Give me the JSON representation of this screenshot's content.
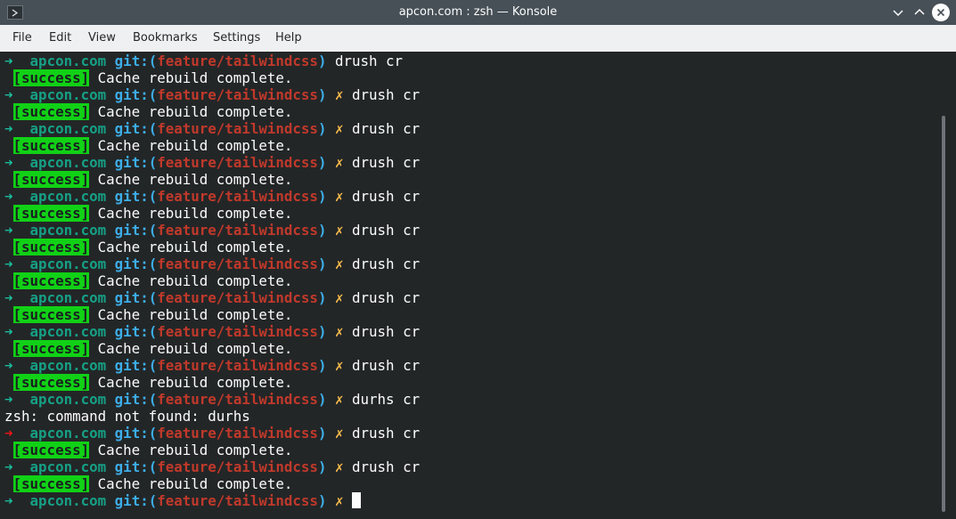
{
  "window": {
    "title": "apcon.com : zsh — Konsole",
    "icons": {
      "app": "terminal-icon",
      "minimize": "chevron-down-icon",
      "maximize": "chevron-up-icon",
      "close": "close-icon"
    }
  },
  "menu": [
    "File",
    "Edit",
    "View",
    "Bookmarks",
    "Settings",
    "Help"
  ],
  "prompt": {
    "arrow": "➜",
    "host": "apcon.com",
    "git_open": "git:(",
    "branch": "feature/tailwindcss",
    "git_close": ")",
    "dirty": "✗"
  },
  "terminal_lines": [
    {
      "kind": "prompt",
      "status": "ok",
      "dirty": false,
      "cmd": "drush cr"
    },
    {
      "kind": "success",
      "badge": "[success]",
      "text": "Cache rebuild complete."
    },
    {
      "kind": "prompt",
      "status": "ok",
      "dirty": true,
      "cmd": "drush cr"
    },
    {
      "kind": "success",
      "badge": "[success]",
      "text": "Cache rebuild complete."
    },
    {
      "kind": "prompt",
      "status": "ok",
      "dirty": true,
      "cmd": "drush cr"
    },
    {
      "kind": "success",
      "badge": "[success]",
      "text": "Cache rebuild complete."
    },
    {
      "kind": "prompt",
      "status": "ok",
      "dirty": true,
      "cmd": "drush cr"
    },
    {
      "kind": "success",
      "badge": "[success]",
      "text": "Cache rebuild complete."
    },
    {
      "kind": "prompt",
      "status": "ok",
      "dirty": true,
      "cmd": "drush cr"
    },
    {
      "kind": "success",
      "badge": "[success]",
      "text": "Cache rebuild complete."
    },
    {
      "kind": "prompt",
      "status": "ok",
      "dirty": true,
      "cmd": "drush cr"
    },
    {
      "kind": "success",
      "badge": "[success]",
      "text": "Cache rebuild complete."
    },
    {
      "kind": "prompt",
      "status": "ok",
      "dirty": true,
      "cmd": "drush cr"
    },
    {
      "kind": "success",
      "badge": "[success]",
      "text": "Cache rebuild complete."
    },
    {
      "kind": "prompt",
      "status": "ok",
      "dirty": true,
      "cmd": "drush cr"
    },
    {
      "kind": "success",
      "badge": "[success]",
      "text": "Cache rebuild complete."
    },
    {
      "kind": "prompt",
      "status": "ok",
      "dirty": true,
      "cmd": "drush cr"
    },
    {
      "kind": "success",
      "badge": "[success]",
      "text": "Cache rebuild complete."
    },
    {
      "kind": "prompt",
      "status": "ok",
      "dirty": true,
      "cmd": "drush cr"
    },
    {
      "kind": "success",
      "badge": "[success]",
      "text": "Cache rebuild complete."
    },
    {
      "kind": "prompt",
      "status": "ok",
      "dirty": true,
      "cmd": "durhs cr"
    },
    {
      "kind": "error",
      "text": "zsh: command not found: durhs"
    },
    {
      "kind": "prompt",
      "status": "err",
      "dirty": true,
      "cmd": "drush cr"
    },
    {
      "kind": "success",
      "badge": "[success]",
      "text": "Cache rebuild complete."
    },
    {
      "kind": "prompt",
      "status": "ok",
      "dirty": true,
      "cmd": "drush cr"
    },
    {
      "kind": "success",
      "badge": "[success]",
      "text": "Cache rebuild complete."
    },
    {
      "kind": "prompt",
      "status": "ok",
      "dirty": true,
      "cmd": "",
      "cursor": true
    }
  ],
  "colors": {
    "terminal_bg": "#232627",
    "prompt_ok": "#1abc9c",
    "prompt_err": "#ed1515",
    "host": "#16a085",
    "git": "#3daee9",
    "branch": "#c0392b",
    "dirty": "#fdbc4b",
    "success_badge": "#11d116"
  }
}
